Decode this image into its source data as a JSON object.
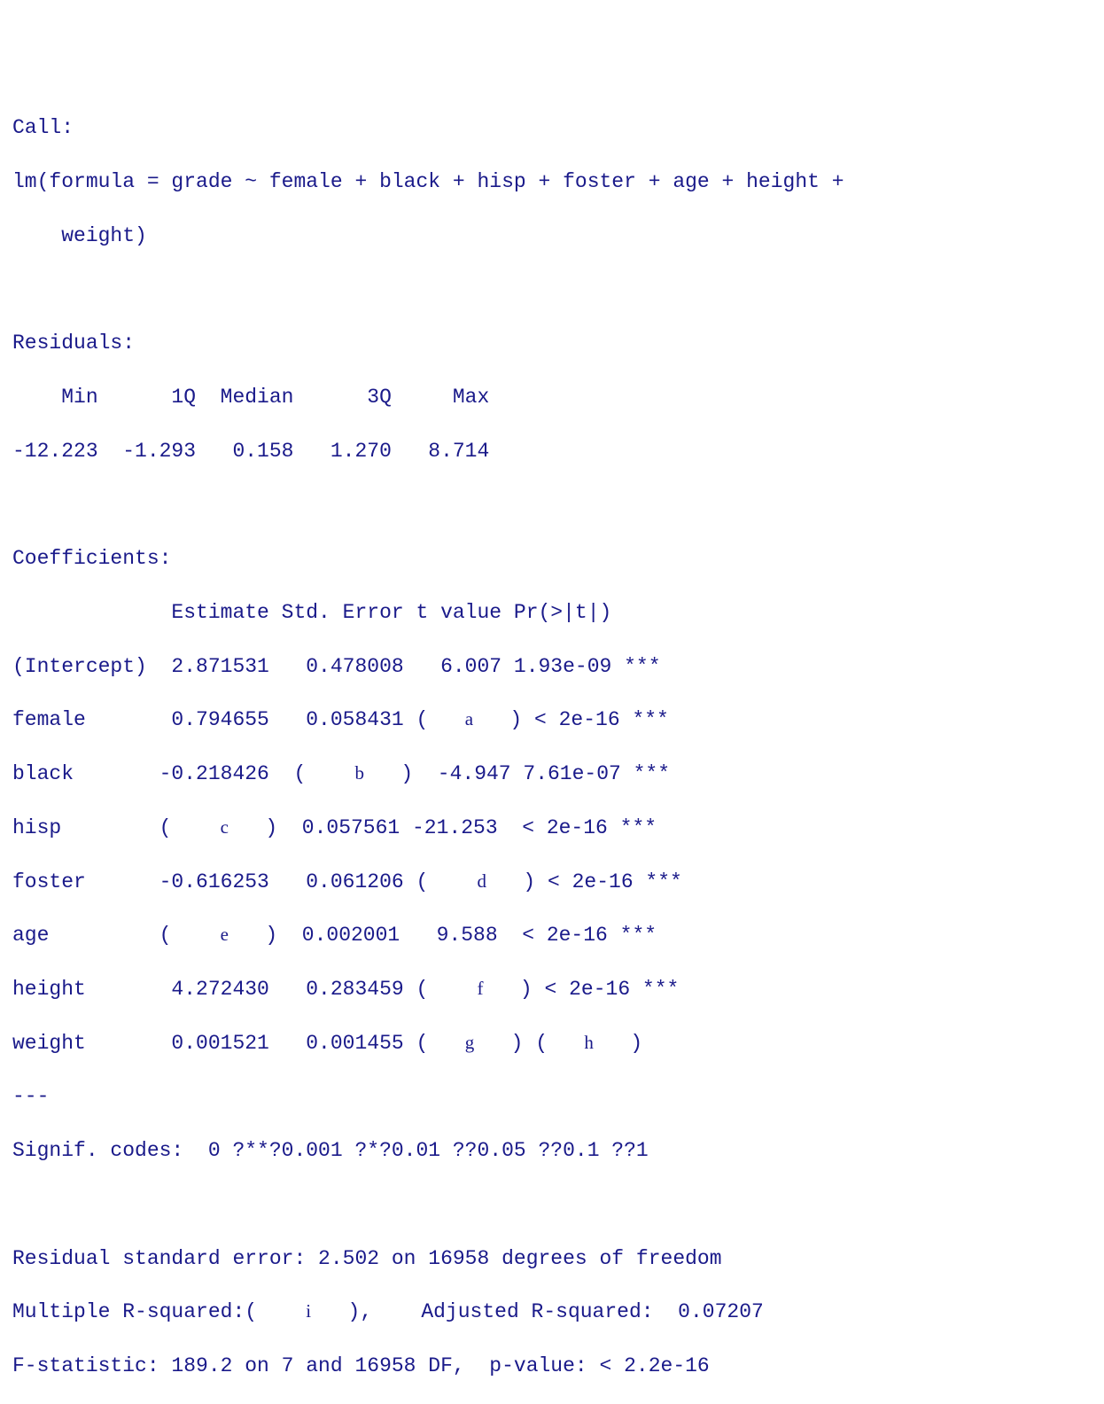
{
  "call": {
    "title": "Call:",
    "line1": "lm(formula = grade ~ female + black + hisp + foster + age + height + ",
    "line2": "    weight)"
  },
  "residuals": {
    "title": "Residuals:",
    "hdr": "    Min      1Q  Median      3Q     Max ",
    "vals": "-12.223  -1.293   0.158   1.270   8.714 "
  },
  "coef": {
    "title": "Coefficients:",
    "hdr": "             Estimate Std. Error t value Pr(>|t|)    ",
    "intercept": {
      "pre": "(Intercept)  2.871531   0.478008   6.007 1.93e-09 ***"
    },
    "female": {
      "pre": "female       0.794655   0.058431 (   ",
      "ph": "a",
      "post": "   ) < 2e-16 ***"
    },
    "black": {
      "pre": "black       -0.218426  (    ",
      "ph": "b",
      "post": "   )  -4.947 7.61e-07 ***"
    },
    "hisp": {
      "pre": "hisp        (    ",
      "ph": "c",
      "post": "   )  0.057561 -21.253  < 2e-16 ***"
    },
    "foster": {
      "pre": "foster      -0.616253   0.061206 (    ",
      "ph": "d",
      "post": "   ) < 2e-16 ***"
    },
    "age": {
      "pre": "age         (    ",
      "ph": "e",
      "post": "   )  0.002001   9.588  < 2e-16 ***"
    },
    "height": {
      "pre": "height       4.272430   0.283459 (    ",
      "ph": "f",
      "post": "   ) < 2e-16 ***"
    },
    "weight": {
      "pre": "weight       0.001521   0.001455 (   ",
      "ph1": "g",
      "mid": "   ) (   ",
      "ph2": "h",
      "post": "   )"
    },
    "sep": "---",
    "signif": "Signif. codes:  0 ?**?0.001 ?*?0.01 ??0.05 ??0.1 ??1"
  },
  "foot": {
    "rse": "Residual standard error: 2.502 on 16958 degrees of freedom",
    "r2": {
      "pre": "Multiple R-squared:(    ",
      "ph": "i",
      "post": "   ),    Adjusted R-squared:  0.07207"
    },
    "f": "F-statistic: 189.2 on 7 and 16958 DF,  p-value: < 2.2e-16"
  },
  "chart_data": {
    "type": "table",
    "title": "lm summary: grade ~ female + black + hisp + foster + age + height + weight",
    "residuals": {
      "Min": -12.223,
      "1Q": -1.293,
      "Median": 0.158,
      "3Q": 1.27,
      "Max": 8.714
    },
    "coefficients": {
      "columns": [
        "Estimate",
        "Std. Error",
        "t value",
        "Pr(>|t|)",
        "signif"
      ],
      "rows": {
        "(Intercept)": {
          "Estimate": 2.871531,
          "Std. Error": 0.478008,
          "t value": 6.007,
          "Pr(>|t|)": "1.93e-09",
          "signif": "***"
        },
        "female": {
          "Estimate": 0.794655,
          "Std. Error": 0.058431,
          "t value": "(a)",
          "Pr(>|t|)": "< 2e-16",
          "signif": "***"
        },
        "black": {
          "Estimate": -0.218426,
          "Std. Error": "(b)",
          "t value": -4.947,
          "Pr(>|t|)": "7.61e-07",
          "signif": "***"
        },
        "hisp": {
          "Estimate": "(c)",
          "Std. Error": 0.057561,
          "t value": -21.253,
          "Pr(>|t|)": "< 2e-16",
          "signif": "***"
        },
        "foster": {
          "Estimate": -0.616253,
          "Std. Error": 0.061206,
          "t value": "(d)",
          "Pr(>|t|)": "< 2e-16",
          "signif": "***"
        },
        "age": {
          "Estimate": "(e)",
          "Std. Error": 0.002001,
          "t value": 9.588,
          "Pr(>|t|)": "< 2e-16",
          "signif": "***"
        },
        "height": {
          "Estimate": 4.27243,
          "Std. Error": 0.283459,
          "t value": "(f)",
          "Pr(>|t|)": "< 2e-16",
          "signif": "***"
        },
        "weight": {
          "Estimate": 0.001521,
          "Std. Error": 0.001455,
          "t value": "(g)",
          "Pr(>|t|)": "(h)",
          "signif": ""
        }
      }
    },
    "signif_codes": "0 '***' 0.001 '**' 0.01 '*' 0.05 '.' 0.1 ' ' 1",
    "residual_standard_error": 2.502,
    "df_residual": 16958,
    "multiple_r_squared": "(i)",
    "adjusted_r_squared": 0.07207,
    "f_statistic": {
      "value": 189.2,
      "df1": 7,
      "df2": 16958,
      "p_value": "< 2.2e-16"
    }
  }
}
